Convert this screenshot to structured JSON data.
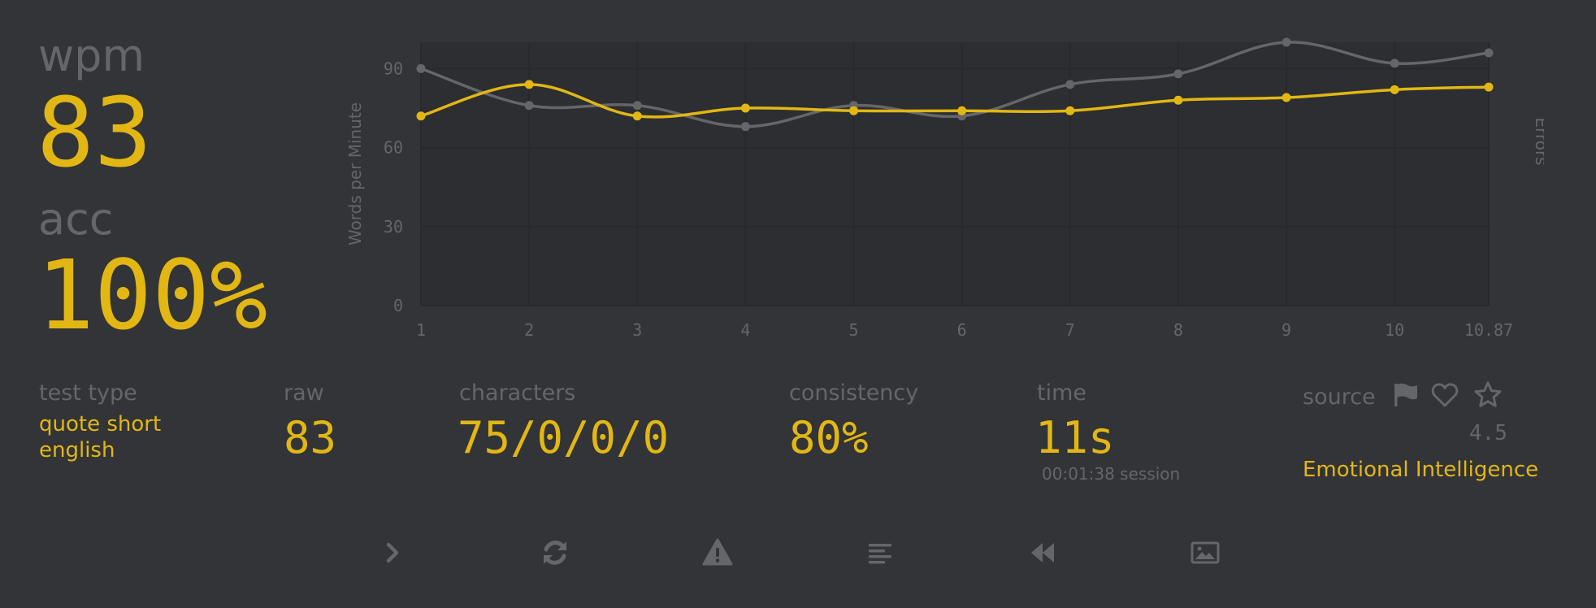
{
  "wpm": {
    "label": "wpm",
    "value": "83"
  },
  "acc": {
    "label": "acc",
    "value": "100%"
  },
  "stats": {
    "test_type": {
      "label": "test type",
      "line1": "quote short",
      "line2": "english"
    },
    "raw": {
      "label": "raw",
      "value": "83"
    },
    "characters": {
      "label": "characters",
      "value": "75/0/0/0"
    },
    "consistency": {
      "label": "consistency",
      "value": "80%"
    },
    "time": {
      "label": "time",
      "value": "11s",
      "session": "00:01:38 session"
    },
    "source": {
      "label": "source",
      "rating": "4.5",
      "title": "Emotional Intelligence"
    }
  },
  "icons": {
    "source": [
      "flag-icon",
      "heart-icon",
      "star-icon"
    ],
    "actions": [
      "next-test-icon",
      "restart-icon",
      "report-warning-icon",
      "words-history-icon",
      "replay-icon",
      "screenshot-icon"
    ]
  },
  "colors": {
    "background": "#323437",
    "main": "#e2b714",
    "sub": "#646669",
    "plot_bg": "#2c2e31"
  },
  "chart_data": {
    "type": "line",
    "x": [
      1,
      2,
      3,
      4,
      5,
      6,
      7,
      8,
      9,
      10,
      10.87
    ],
    "x_tick_labels": [
      "1",
      "2",
      "3",
      "4",
      "5",
      "6",
      "7",
      "8",
      "9",
      "10",
      "10.87"
    ],
    "y_ticks": [
      0,
      30,
      60,
      90
    ],
    "ylim": [
      0,
      100
    ],
    "ylabel": "Words per Minute",
    "y2label": "Errors",
    "grid": true,
    "series": [
      {
        "color": "#646669",
        "values": [
          90,
          76,
          76,
          68,
          76,
          72,
          84,
          88,
          100,
          92,
          96
        ]
      },
      {
        "color": "#e2b714",
        "values": [
          72,
          84,
          72,
          75,
          74,
          74,
          74,
          78,
          79,
          82,
          83
        ]
      }
    ]
  }
}
